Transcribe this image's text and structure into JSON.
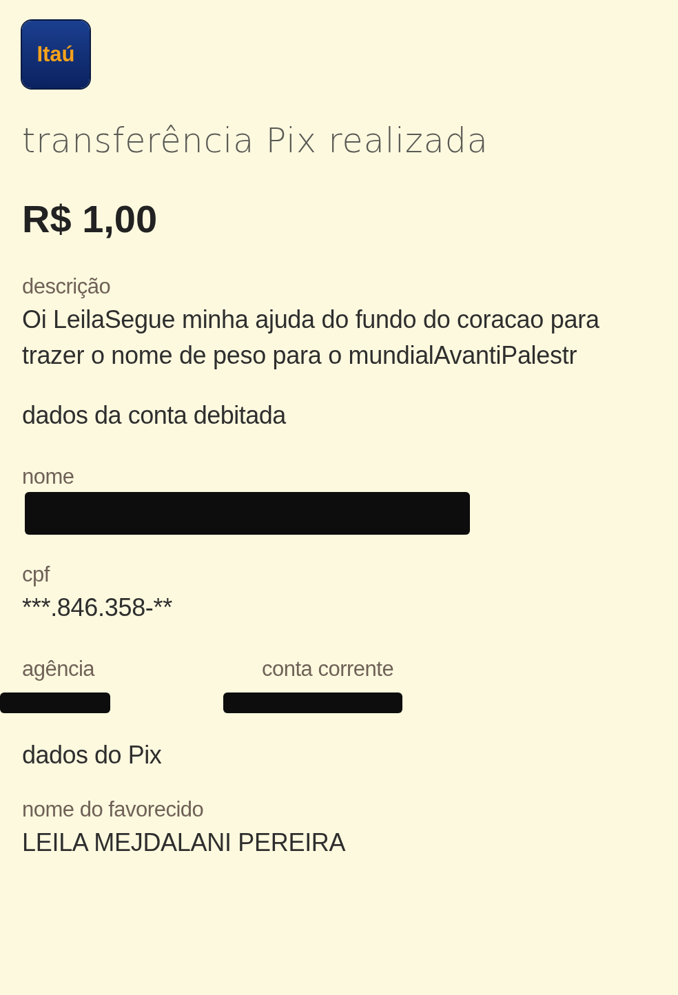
{
  "logo": {
    "text": "Itaú"
  },
  "title": "transferência Pix realizada",
  "amount": "R$ 1,00",
  "rows": [
    {
      "kind": "field",
      "label": "descrição",
      "value": "Oi LeilaSegue minha ajuda do fundo do coracao para trazer o nome de peso para o mundialAvantiPalestr"
    },
    {
      "kind": "heading",
      "text": "dados da conta debitada"
    },
    {
      "kind": "redacted",
      "label": "nome"
    },
    {
      "kind": "field",
      "label": "cpf",
      "value": "***.846.358-**"
    },
    {
      "kind": "pair",
      "labels": [
        "agência",
        "conta corrente"
      ]
    },
    {
      "kind": "heading",
      "text": "dados do Pix"
    },
    {
      "kind": "field",
      "label": "nome do favorecido",
      "value": "LEILA MEJDALANI PEREIRA"
    }
  ]
}
